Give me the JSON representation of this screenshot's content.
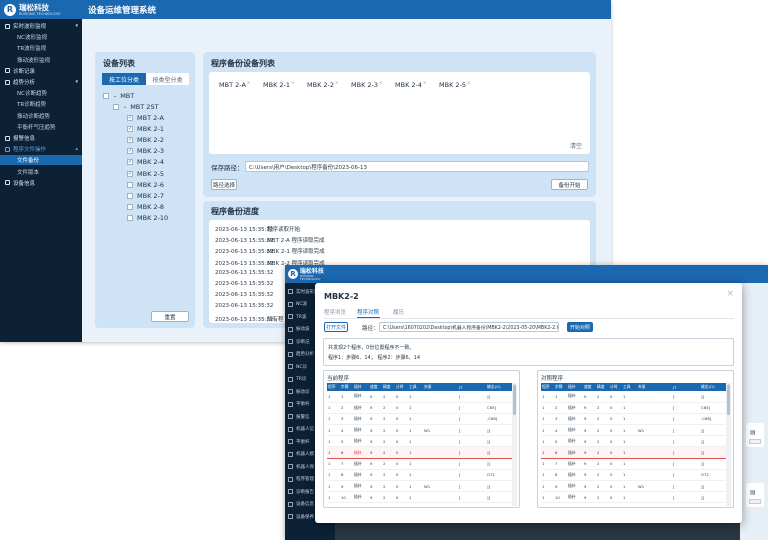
{
  "back_window": {
    "logo": {
      "name": "瑞松科技",
      "sub": "RUISONG TECHNOLOGY",
      "mark": "R"
    },
    "app_title": "设备运维管理系统",
    "sidebar": [
      {
        "label": "实时波形监视",
        "type": "group",
        "caret": "▾"
      },
      {
        "label": "NC波形监视",
        "type": "sub"
      },
      {
        "label": "TR波形监视",
        "type": "sub"
      },
      {
        "label": "振动波形监视",
        "type": "sub"
      },
      {
        "label": "诊断记录",
        "type": "group",
        "caret": ""
      },
      {
        "label": "趋势分析",
        "type": "group",
        "caret": "▾"
      },
      {
        "label": "NC诊断趋势",
        "type": "sub"
      },
      {
        "label": "TR诊断趋势",
        "type": "sub"
      },
      {
        "label": "振动诊断趋势",
        "type": "sub"
      },
      {
        "label": "平衡杆气压趋势",
        "type": "sub"
      },
      {
        "label": "报警信息",
        "type": "group",
        "caret": ""
      },
      {
        "label": "程序文件操作",
        "type": "group-open",
        "caret": "▴"
      },
      {
        "label": "文件备份",
        "type": "sub-active"
      },
      {
        "label": "文件版本",
        "type": "sub"
      },
      {
        "label": "设备信息",
        "type": "group",
        "caret": ""
      }
    ],
    "device_list": {
      "title": "设备列表",
      "tab_process": "按工位分类",
      "tab_type": "按类型分类",
      "tree_root": "MBT",
      "tree_group": "MBT 2ST",
      "devices": [
        {
          "label": "MBT 2-A",
          "checked": true
        },
        {
          "label": "MBK 2-1",
          "checked": true
        },
        {
          "label": "MBK 2-2",
          "checked": true
        },
        {
          "label": "MBK 2-3",
          "checked": true
        },
        {
          "label": "MBK 2-4",
          "checked": true
        },
        {
          "label": "MBK 2-5",
          "checked": true
        },
        {
          "label": "MBK 2-6",
          "checked": false
        },
        {
          "label": "MBK 2-7",
          "checked": false
        },
        {
          "label": "MBK 2-8",
          "checked": false
        },
        {
          "label": "MBK 2-10",
          "checked": false
        }
      ],
      "reset_button": "重置"
    },
    "backup": {
      "title": "程序备份设备列表",
      "selected": [
        "MBT 2-A",
        "MBK 2-1",
        "MBK 2-2",
        "MBK 2-3",
        "MBK 2-4",
        "MBK 2-5"
      ],
      "clear": "清空",
      "path_label": "保存路径：",
      "path_value": "C:\\Users\\用户\\Desktop\\程序备份\\2023-06-13",
      "choose_path": "路径选择",
      "start_backup": "备份开始"
    },
    "progress": {
      "title": "程序备份进度",
      "lines": [
        {
          "ts": "2023-06-13 15:35:32",
          "msg": "程序读取开始"
        },
        {
          "ts": "2023-06-13 15:35:32",
          "msg": "MBT 2-A 程序读取完成"
        },
        {
          "ts": "2023-06-13 15:35:32",
          "msg": "MBK 2-1 程序读取完成"
        },
        {
          "ts": "2023-06-13 15:35:32",
          "msg": "MBK 2-2 程序读取完成"
        },
        {
          "ts": "2023-06-13 15:35:32",
          "msg": ""
        },
        {
          "ts": "2023-06-13 15:35:32",
          "msg": ""
        },
        {
          "ts": "2023-06-13 15:35:32",
          "msg": ""
        },
        {
          "ts": "2023-06-13 15:35:32",
          "msg": ""
        },
        {
          "ts": "2023-06-13 15:35:32",
          "msg": "所有程"
        }
      ]
    }
  },
  "middle_window": {
    "logo": {
      "name": "瑞松科技",
      "sub": "RUISONG TECHNOLOGY",
      "mark": "R"
    },
    "sidebar": [
      "实时波形监",
      "NC波",
      "TR波",
      "振动波",
      "诊断记",
      "趋势分析",
      "NC诊",
      "TR诊",
      "振动诊",
      "平衡杆",
      "报警信",
      "机器人信",
      "平衡杆",
      "机器人模",
      "机器人保",
      "程序管理",
      "诊断报告",
      "设备信息",
      "设备保养"
    ]
  },
  "modal": {
    "title": "MBK2-2",
    "tabs": [
      "程序浏览",
      "程序对照",
      "履历"
    ],
    "active_tab": 1,
    "open_file": "打开文件",
    "path_label": "路径：",
    "path_value": "C:\\Users\\16070202\\Desktop\\机器人程序备份\\MBK2-2\\2023-05-20\\MBK2-2.txt",
    "start_compare": "开始对照",
    "result_line1": "共发现2个程序，0份位置程序不一致。",
    "result_line2": "程序1：步骤6、14；  程序2：步骤6、14",
    "current_title": "当前程序",
    "compare_title": "对照程序",
    "columns": [
      "程序",
      "步骤",
      "插补",
      "速度",
      "精度",
      "计时",
      "工具",
      "夹紧",
      "JT",
      "输出(O)"
    ],
    "left_rows": [
      [
        "1",
        "1",
        "插补",
        "0",
        "2",
        "0",
        "1",
        "",
        "[",
        "]]"
      ],
      [
        "1",
        "2",
        "插补",
        "9",
        "2",
        "0",
        "1",
        "",
        "[",
        "C65]"
      ],
      [
        "1",
        "3",
        "插补",
        "9",
        "2",
        "0",
        "1",
        "",
        "[",
        "-C66]"
      ],
      [
        "1",
        "4",
        "插补",
        "9",
        "2",
        "0",
        "1",
        "W1",
        "[",
        "]]"
      ],
      [
        "1",
        "5",
        "插补",
        "9",
        "2",
        "0",
        "1",
        "",
        "[",
        "]]"
      ],
      [
        "1",
        "6",
        "插补",
        "9",
        "2",
        "0",
        "1",
        "",
        "[",
        "]]"
      ],
      [
        "1",
        "7",
        "插补",
        "9",
        "2",
        "0",
        "1",
        "",
        "[",
        "]]"
      ],
      [
        "1",
        "8",
        "插补",
        "9",
        "2",
        "0",
        "1",
        "",
        "[",
        "O72"
      ],
      [
        "1",
        "9",
        "插补",
        "9",
        "2",
        "0",
        "1",
        "W1",
        "[",
        "]]"
      ],
      [
        "1",
        "10",
        "插补",
        "9",
        "2",
        "0",
        "1",
        "",
        "[",
        "]]"
      ]
    ],
    "right_rows": [
      [
        "1",
        "1",
        "插补",
        "0",
        "2",
        "0",
        "1",
        "",
        "[",
        "]]"
      ],
      [
        "1",
        "2",
        "插补",
        "9",
        "2",
        "0",
        "1",
        "",
        "[",
        "C65]"
      ],
      [
        "1",
        "3",
        "插补",
        "9",
        "2",
        "0",
        "1",
        "",
        "[",
        "-C66]"
      ],
      [
        "1",
        "4",
        "插补",
        "9",
        "2",
        "0",
        "1",
        "W1",
        "[",
        "]]"
      ],
      [
        "1",
        "5",
        "插补",
        "9",
        "2",
        "0",
        "1",
        "",
        "[",
        "]]"
      ],
      [
        "1",
        "6",
        "插补",
        "9",
        "2",
        "0",
        "1",
        "",
        "[",
        "]]"
      ],
      [
        "1",
        "7",
        "插补",
        "9",
        "2",
        "0",
        "1",
        "",
        "[",
        "]]"
      ],
      [
        "1",
        "8",
        "插补",
        "9",
        "2",
        "0",
        "1",
        "",
        "[",
        "O72"
      ],
      [
        "1",
        "9",
        "插补",
        "9",
        "2",
        "0",
        "1",
        "W1",
        "[",
        "]]"
      ],
      [
        "1",
        "10",
        "插补",
        "9",
        "2",
        "0",
        "1",
        "",
        "[",
        "]]"
      ]
    ],
    "highlight_row": 5,
    "highlight_cell": 2
  },
  "colors": {
    "brand": "#1a68b0",
    "sidebar": "#0c2136",
    "panel": "#cfe3f6",
    "diff": "#e05050"
  }
}
